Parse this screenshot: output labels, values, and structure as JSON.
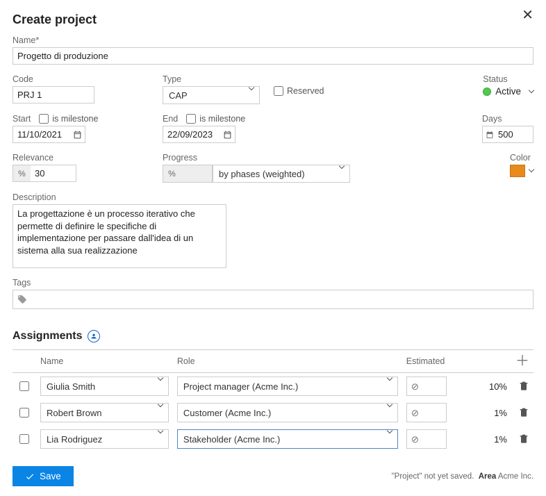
{
  "header": {
    "title": "Create project"
  },
  "fields": {
    "name": {
      "label": "Name",
      "value": "Progetto di produzione"
    },
    "code": {
      "label": "Code",
      "value": "PRJ 1"
    },
    "type": {
      "label": "Type",
      "value": "CAP"
    },
    "reserved": {
      "label": "Reserved",
      "checked": false
    },
    "status": {
      "label": "Status",
      "value": "Active",
      "color": "#4fc94f"
    },
    "start": {
      "label": "Start",
      "value": "11/10/2021"
    },
    "start_milestone": {
      "label": "is milestone",
      "checked": false
    },
    "end": {
      "label": "End",
      "value": "22/09/2023"
    },
    "end_milestone": {
      "label": "is milestone",
      "checked": false
    },
    "days": {
      "label": "Days",
      "value": "500"
    },
    "relevance": {
      "label": "Relevance",
      "value": "30",
      "prefix": "%"
    },
    "progress": {
      "label": "Progress",
      "mode": "by phases (weighted)",
      "prefix": "%"
    },
    "color": {
      "label": "Color",
      "hex": "#e78a1b"
    },
    "description": {
      "label": "Description",
      "value": "La progettazione è un processo iterativo che permette di definire le specifiche di implementazione per passare dall'idea di un sistema alla sua realizzazione"
    },
    "tags": {
      "label": "Tags"
    }
  },
  "assignments": {
    "title": "Assignments",
    "columns": {
      "name": "Name",
      "role": "Role",
      "estimated": "Estimated"
    },
    "est_placeholder": "⊘",
    "rows": [
      {
        "name": "Giulia Smith",
        "role": "Project manager (Acme Inc.)",
        "pct": "10%"
      },
      {
        "name": "Robert Brown",
        "role": "Customer (Acme Inc.)",
        "pct": "1%"
      },
      {
        "name": "Lia Rodriguez",
        "role": "Stakeholder (Acme Inc.)",
        "pct": "1%",
        "role_selected": true
      }
    ]
  },
  "footer": {
    "save": "Save",
    "note_pre": "\"Project\" not yet saved.",
    "area_label": "Area",
    "area_value": "Acme Inc."
  }
}
